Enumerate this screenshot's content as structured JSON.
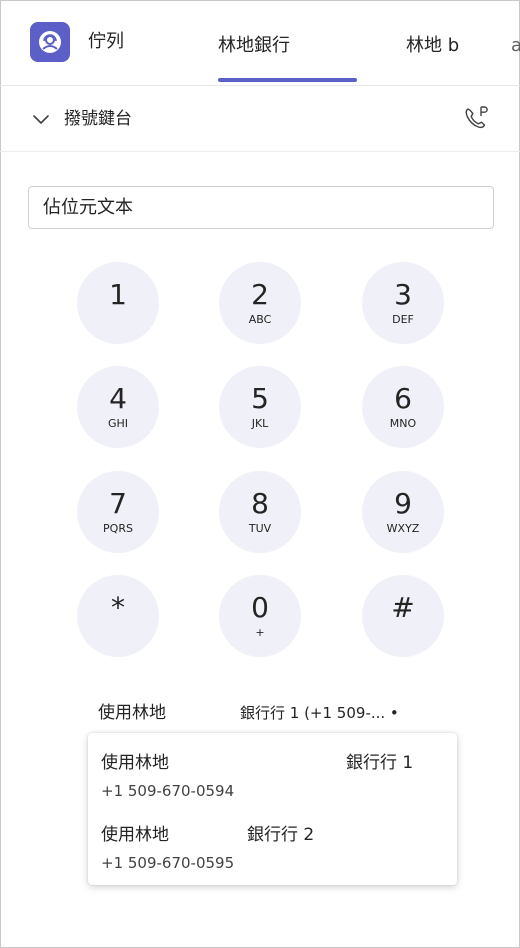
{
  "tabs": [
    {
      "label": "佇列"
    },
    {
      "label": "林地銀行"
    },
    {
      "label": "林地 b"
    },
    {
      "label": "a"
    }
  ],
  "dialpad": {
    "toggle_label": "撥號鍵台",
    "input_placeholder": "佔位元文本",
    "keys": [
      {
        "digit": "1",
        "letters": ""
      },
      {
        "digit": "2",
        "letters": "ABC"
      },
      {
        "digit": "3",
        "letters": "DEF"
      },
      {
        "digit": "4",
        "letters": "GHI"
      },
      {
        "digit": "5",
        "letters": "JKL"
      },
      {
        "digit": "6",
        "letters": "MNO"
      },
      {
        "digit": "7",
        "letters": "PQRS"
      },
      {
        "digit": "8",
        "letters": "TUV"
      },
      {
        "digit": "9",
        "letters": "WXYZ"
      },
      {
        "digit": "*",
        "letters": ""
      },
      {
        "digit": "0",
        "letters": "+"
      },
      {
        "digit": "#",
        "letters": ""
      }
    ]
  },
  "caller_id": {
    "label": "使用林地",
    "selected": "銀行行 1 (+1 509-... •"
  },
  "dropdown": {
    "options": [
      {
        "name": "使用林地",
        "line": "銀行行 1",
        "number": "+1 509-670-0594"
      },
      {
        "name": "使用林地",
        "line": "銀行行 2",
        "number": "+1 509-670-0595"
      }
    ]
  },
  "colors": {
    "accent": "#5b5fc7",
    "key_bg": "#f0f0f8"
  },
  "icons": {
    "app": "headset-person-icon",
    "toggle": "chevron-down-icon",
    "park": "phone-park-icon"
  }
}
